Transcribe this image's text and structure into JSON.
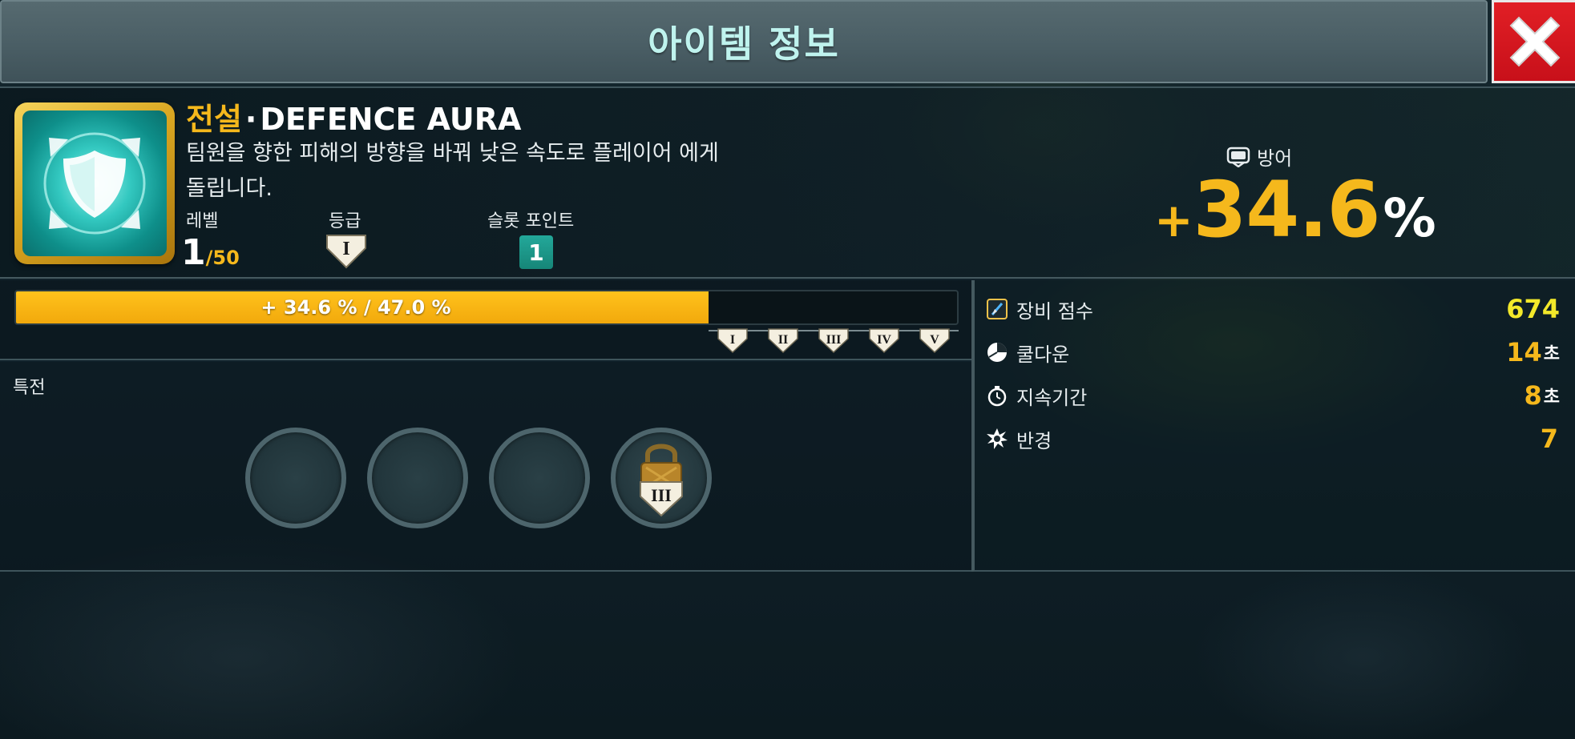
{
  "header": {
    "title": "아이템 정보"
  },
  "item": {
    "rarity": "전설",
    "separator": "·",
    "name": "DEFENCE AURA",
    "description": "팀원을 향한 피해의 방향을 바꿔 낮은 속도로 플레이어 에게 돌립니다.",
    "icon": "shield-aura-icon",
    "level_label": "레벨",
    "level_current": "1",
    "level_slash": "/",
    "level_max": "50",
    "grade_label": "등급",
    "grade_value": "I",
    "slot_points_label": "슬롯 포인트",
    "slot_points_value": "1"
  },
  "bonus": {
    "label": "방어",
    "plus": "+",
    "value": "34.6",
    "unit": "%"
  },
  "progress": {
    "text": "+ 34.6 % / 47.0 %",
    "fraction": 0.736,
    "tiers": [
      "I",
      "II",
      "III",
      "IV",
      "V"
    ]
  },
  "perks": {
    "title": "특전",
    "slots": [
      {
        "locked": false
      },
      {
        "locked": false
      },
      {
        "locked": false
      },
      {
        "locked": true,
        "required_tier": "III"
      }
    ]
  },
  "stats": [
    {
      "label": "장비 점수",
      "value": "674",
      "unit": "",
      "icon": "gear-score-icon"
    },
    {
      "label": "쿨다운",
      "value": "14",
      "unit": "초",
      "icon": "cooldown-icon"
    },
    {
      "label": "지속기간",
      "value": "8",
      "unit": "초",
      "icon": "stopwatch-icon"
    },
    {
      "label": "반경",
      "value": "7",
      "unit": "",
      "icon": "radius-icon"
    }
  ],
  "colors": {
    "accent_gold": "#f5b81c",
    "teal": "#1e9e90",
    "close_red": "#d8141c"
  }
}
